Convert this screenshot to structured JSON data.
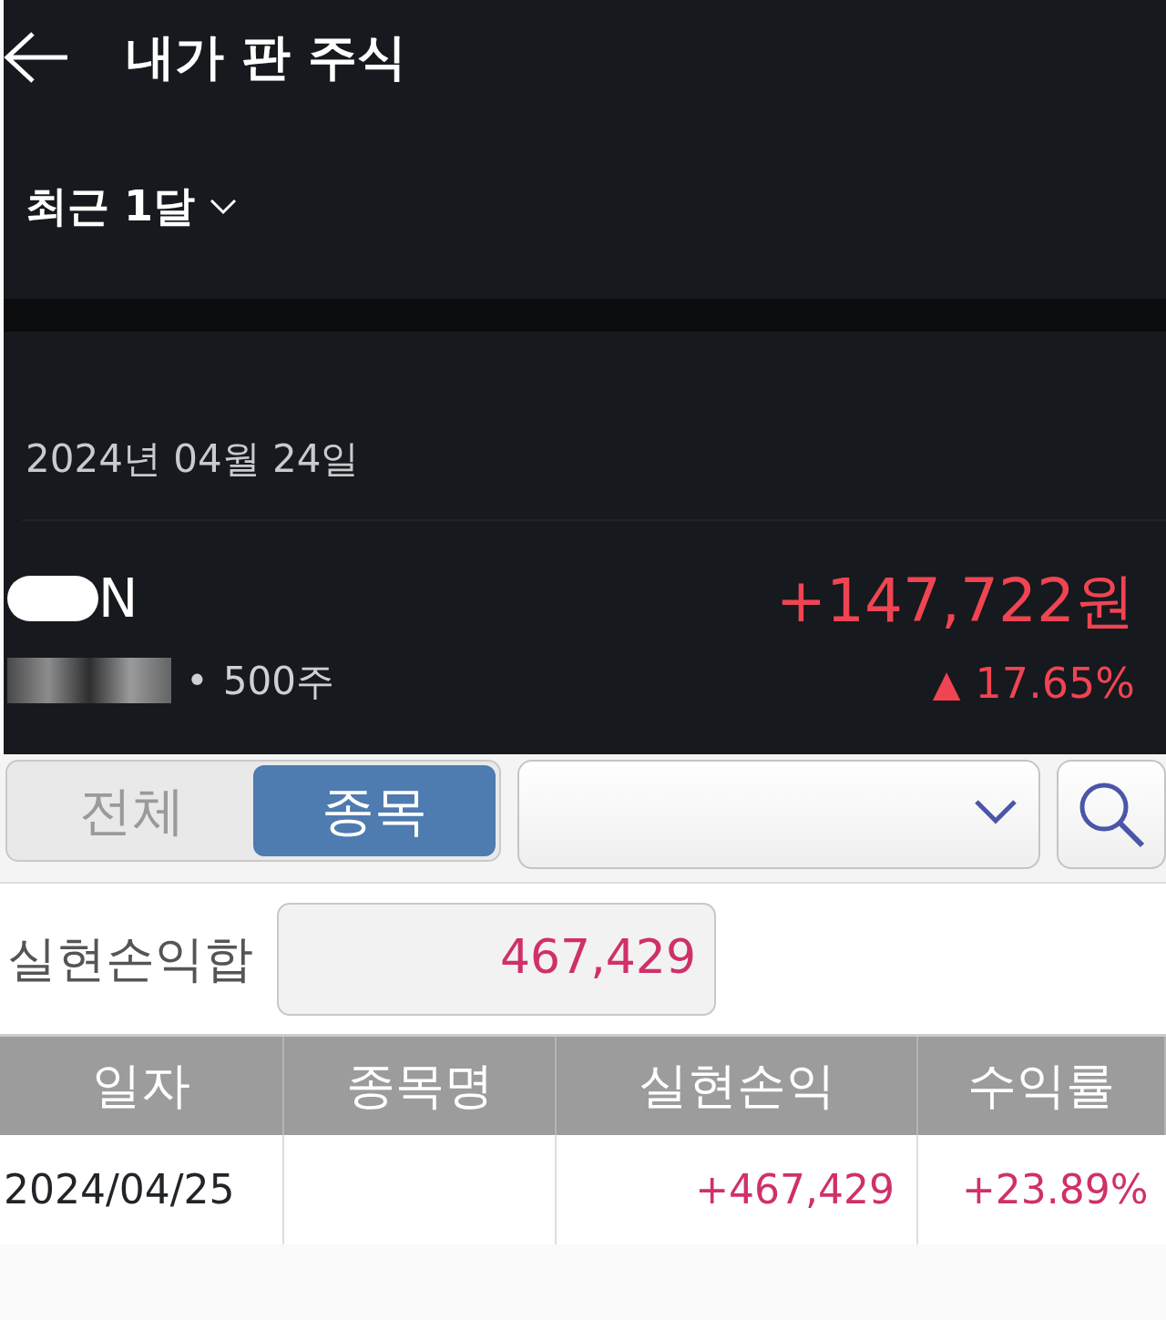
{
  "header": {
    "title": "내가 판 주식"
  },
  "period": {
    "label": "최근 1달"
  },
  "sale": {
    "date": "2024년 04월 24일",
    "stock_name": "N",
    "separator": "•",
    "shares": "500주",
    "profit": "+147,722원",
    "arrow": "▲",
    "rate": "17.65%"
  },
  "tabs": [
    {
      "label": "전체",
      "selected": false
    },
    {
      "label": "종목",
      "selected": true
    }
  ],
  "summary": {
    "label": "실현손익합",
    "value": "467,429"
  },
  "table": {
    "columns": [
      "일자",
      "종목명",
      "실현손익",
      "수익률"
    ],
    "rows": [
      {
        "date": "2024/04/25",
        "profit": "+467,429",
        "rate": "+23.89%"
      }
    ]
  }
}
